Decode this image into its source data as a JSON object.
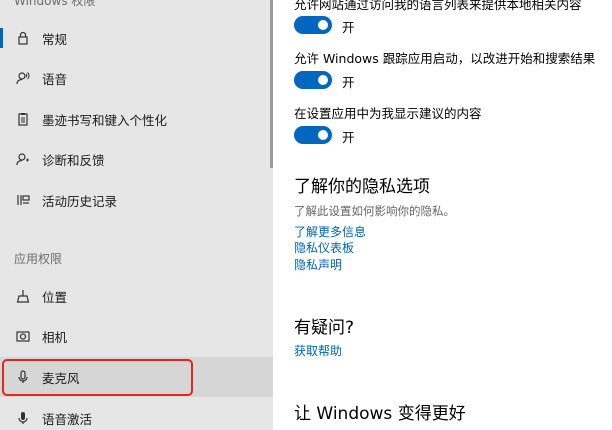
{
  "sidebar": {
    "header": "Windows 权限",
    "items": [
      {
        "label": "常规",
        "icon": "lock-icon"
      },
      {
        "label": "语音",
        "icon": "speech-icon"
      },
      {
        "label": "墨迹书写和键入个性化",
        "icon": "clipboard-icon"
      },
      {
        "label": "诊断和反馈",
        "icon": "feedback-icon"
      },
      {
        "label": "活动历史记录",
        "icon": "timeline-icon"
      },
      {
        "label": "位置",
        "icon": "location-icon"
      },
      {
        "label": "相机",
        "icon": "camera-icon"
      },
      {
        "label": "麦克风",
        "icon": "microphone-icon"
      },
      {
        "label": "语音激活",
        "icon": "voice-activation-icon"
      }
    ],
    "app_permissions_label": "应用权限"
  },
  "main": {
    "settings": [
      {
        "text": "允许网站通过访问我的语言列表来提供本地相关内容",
        "state": "开"
      },
      {
        "text": "允许 Windows 跟踪应用启动，以改进开始和搜索结果",
        "state": "开"
      },
      {
        "text": "在设置应用中为我显示建议的内容",
        "state": "开"
      }
    ],
    "privacy": {
      "title": "了解你的隐私选项",
      "desc": "了解此设置如何影响你的隐私。",
      "links": [
        "了解更多信息",
        "隐私仪表板",
        "隐私声明"
      ]
    },
    "help": {
      "title": "有疑问?",
      "link": "获取帮助"
    },
    "improve": {
      "title": "让 Windows 变得更好"
    }
  },
  "colors": {
    "accent": "#0067c0",
    "link": "#0063b1",
    "highlight_outline": "#e6261c"
  }
}
